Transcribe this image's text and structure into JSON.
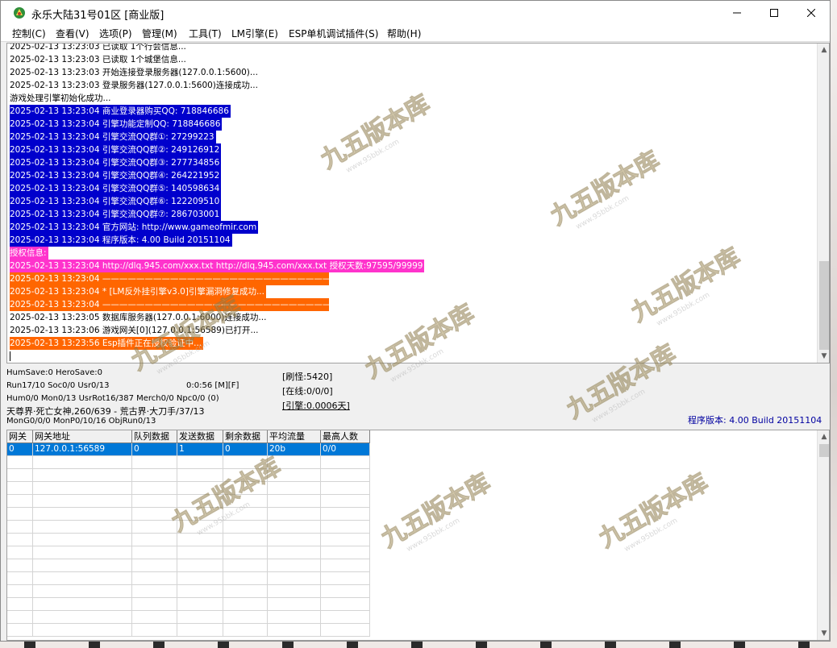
{
  "window": {
    "title": "永乐大陆31号01区 [商业版]"
  },
  "menu": [
    "控制(C)",
    "查看(V)",
    "选项(P)",
    "管理(M)",
    "工具(T)",
    "LM引擎(E)",
    "ESP单机调试插件(S)",
    "帮助(H)"
  ],
  "log": [
    {
      "text": "2025-02-13 13:23:03 已读取 1个行会信息...",
      "bg": "",
      "fg": "#000000"
    },
    {
      "text": "2025-02-13 13:23:03 已读取 1个城堡信息...",
      "bg": "",
      "fg": "#000000"
    },
    {
      "text": "2025-02-13 13:23:03 开始连接登录服务器(127.0.0.1:5600)...",
      "bg": "",
      "fg": "#000000"
    },
    {
      "text": "2025-02-13 13:23:03 登录服务器(127.0.0.1:5600)连接成功...",
      "bg": "",
      "fg": "#000000"
    },
    {
      "text": "游戏处理引擎初始化成功...",
      "bg": "",
      "fg": "#000000"
    },
    {
      "text": "2025-02-13 13:23:04 商业登录器购买QQ: 718846686",
      "bg": "#0000cc",
      "fg": "#ffffff"
    },
    {
      "text": "2025-02-13 13:23:04 引擎功能定制QQ: 718846686",
      "bg": "#0000cc",
      "fg": "#ffffff"
    },
    {
      "text": "2025-02-13 13:23:04 引擎交流QQ群①: 27299223",
      "bg": "#0000cc",
      "fg": "#ffffff"
    },
    {
      "text": "2025-02-13 13:23:04 引擎交流QQ群②: 249126912",
      "bg": "#0000cc",
      "fg": "#ffffff"
    },
    {
      "text": "2025-02-13 13:23:04 引擎交流QQ群③: 277734856",
      "bg": "#0000cc",
      "fg": "#ffffff"
    },
    {
      "text": "2025-02-13 13:23:04 引擎交流QQ群④: 264221952",
      "bg": "#0000cc",
      "fg": "#ffffff"
    },
    {
      "text": "2025-02-13 13:23:04 引擎交流QQ群⑤: 140598634",
      "bg": "#0000cc",
      "fg": "#ffffff"
    },
    {
      "text": "2025-02-13 13:23:04 引擎交流QQ群⑥: 122209510",
      "bg": "#0000cc",
      "fg": "#ffffff"
    },
    {
      "text": "2025-02-13 13:23:04 引擎交流QQ群⑦: 286703001",
      "bg": "#0000cc",
      "fg": "#ffffff"
    },
    {
      "text": "2025-02-13 13:23:04 官方网站: http://www.gameofmir.com",
      "bg": "#0000cc",
      "fg": "#ffffff"
    },
    {
      "text": "2025-02-13 13:23:04 程序版本: 4.00 Build 20151104",
      "bg": "#0000cc",
      "fg": "#ffffff"
    },
    {
      "text": "授权信息:",
      "bg": "#ff33cc",
      "fg": "#ffffff"
    },
    {
      "text": "2025-02-13 13:23:04 http://dlq.945.com/xxx.txt http://dlq.945.com/xxx.txt 授权天数:97595/99999",
      "bg": "#ff33cc",
      "fg": "#ffffff"
    },
    {
      "text": "2025-02-13 13:23:04 ————————————————————————————————————",
      "bg": "#ff6600",
      "fg": "#ffffff"
    },
    {
      "text": "2025-02-13 13:23:04 * [LM反外挂引擎v3.0]引擎漏洞修复成功...",
      "bg": "#ff6600",
      "fg": "#ffffff"
    },
    {
      "text": "2025-02-13 13:23:04 ————————————————————————————————————",
      "bg": "#ff6600",
      "fg": "#ffffff"
    },
    {
      "text": "2025-02-13 13:23:05 数据库服务器(127.0.0.1:6000)连接成功...",
      "bg": "",
      "fg": "#000000"
    },
    {
      "text": "2025-02-13 13:23:06 游戏网关[0](127.0.0.1:56589)已打开...",
      "bg": "",
      "fg": "#000000"
    },
    {
      "text": "2025-02-13 13:23:56 Esp插件正在授权验证中...",
      "bg": "#ff6600",
      "fg": "#ffffff"
    }
  ],
  "status": {
    "line1": "HumSave:0 HeroSave:0",
    "line2": "Run17/10 Soc0/0 Usr0/13",
    "timer": "0:0:56 [M][F]",
    "line3": "Hum0/0 Mon0/13 UsrRot16/387 Merch0/0 Npc0/0 (0)",
    "line4": "天尊界·死亡女神,260/639 - 荒古界·大刀手/37/13",
    "line5": "MonG0/0/0 MonP0/10/16 ObjRun0/13",
    "refresh": "[刷怪:5420]",
    "online": "[在线:0/0/0]",
    "engine": "[引擎:0.0006天]",
    "version": "程序版本: 4.00 Build 20151104"
  },
  "grid": {
    "headers": [
      "网关",
      "网关地址",
      "队列数据",
      "发送数据",
      "剩余数据",
      "平均流量",
      "最高人数"
    ],
    "rows": [
      [
        "0",
        "127.0.0.1:56589",
        "0",
        "1",
        "0",
        "20b",
        "0/0"
      ]
    ]
  },
  "watermark": {
    "title": "九五版本库",
    "url": "www.95bbk.com"
  },
  "colors": {
    "log_blue": "#0000cc",
    "log_pink": "#ff33cc",
    "log_orange": "#ff6600",
    "selection": "#0078d7"
  }
}
